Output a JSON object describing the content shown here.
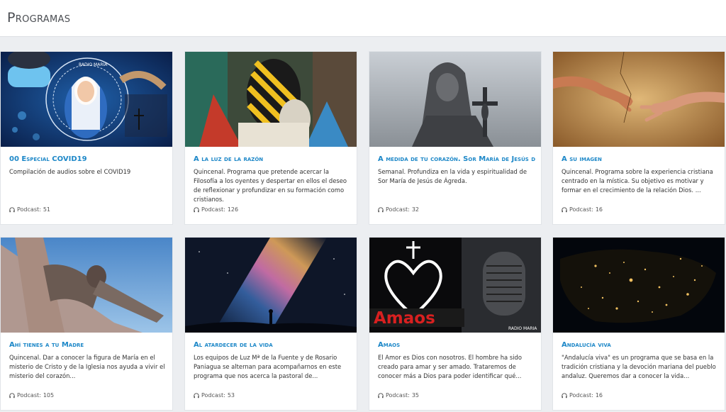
{
  "header": {
    "title": "Programas"
  },
  "podcast_label": "Podcast: ",
  "programs": [
    {
      "title": "00 Especial COVID19",
      "description": "Compilación de audios sobre el COVID19",
      "podcast_count": "51",
      "image": "covid-virgin-mary-banner",
      "image_text": "RADIO MARIA"
    },
    {
      "title": "A la luz de la razón",
      "description": "Quincenal. Programa que pretende acercar la Filosofía a los oyentes y despertar en ellos el deseo de reflexionar y profundizar en su formación como cristianos.",
      "podcast_count": "126",
      "image": "striped-head-painting"
    },
    {
      "title": "A medida de tu corazón. Sor María de Jesús de Ágreda",
      "description": "Semanal. Profundiza en la vida y espiritualidad de Sor María de Jesús de Ágreda.",
      "podcast_count": "32",
      "image": "nun-statue"
    },
    {
      "title": "A su imagen",
      "description": "Quincenal. Programa sobre la experiencia cristiana centrado en la mística. Su objetivo es motivar y formar en el crecimiento de la relación Dios. ...",
      "podcast_count": "16",
      "image": "creation-of-adam-hands"
    },
    {
      "title": "Ahí tienes a tu Madre",
      "description": "Quincenal. Dar a conocer la figura de María en el misterio de Cristo y de la Iglesia nos ayuda a vivir el misterio del corazón...",
      "podcast_count": "105",
      "image": "crucifix-sculpture-sky"
    },
    {
      "title": "Al atardecer de la vida",
      "description": "Los equipos de Luz Mª de la Fuente y de Rosario Paniagua se alternan para acompañarnos en este programa que nos acerca la pastoral de...",
      "podcast_count": "53",
      "image": "milky-way-silhouette"
    },
    {
      "title": "Amaos",
      "description": "El Amor es Dios con nosotros. El hombre ha sido creado para amar y ser amado. Trataremos de conocer más a Dios para poder identificar qué...",
      "podcast_count": "35",
      "image": "amaos-heart-microphone",
      "image_text": "Amaos",
      "image_subtext": "RADIO MARIA"
    },
    {
      "title": "Andalucía viva",
      "description": "\"Andalucía viva\" es un programa que se basa en la tradición cristiana y la devoción mariana del pueblo andaluz. Queremos dar a conocer la vida...",
      "podcast_count": "16",
      "image": "iberia-night-satellite"
    }
  ]
}
